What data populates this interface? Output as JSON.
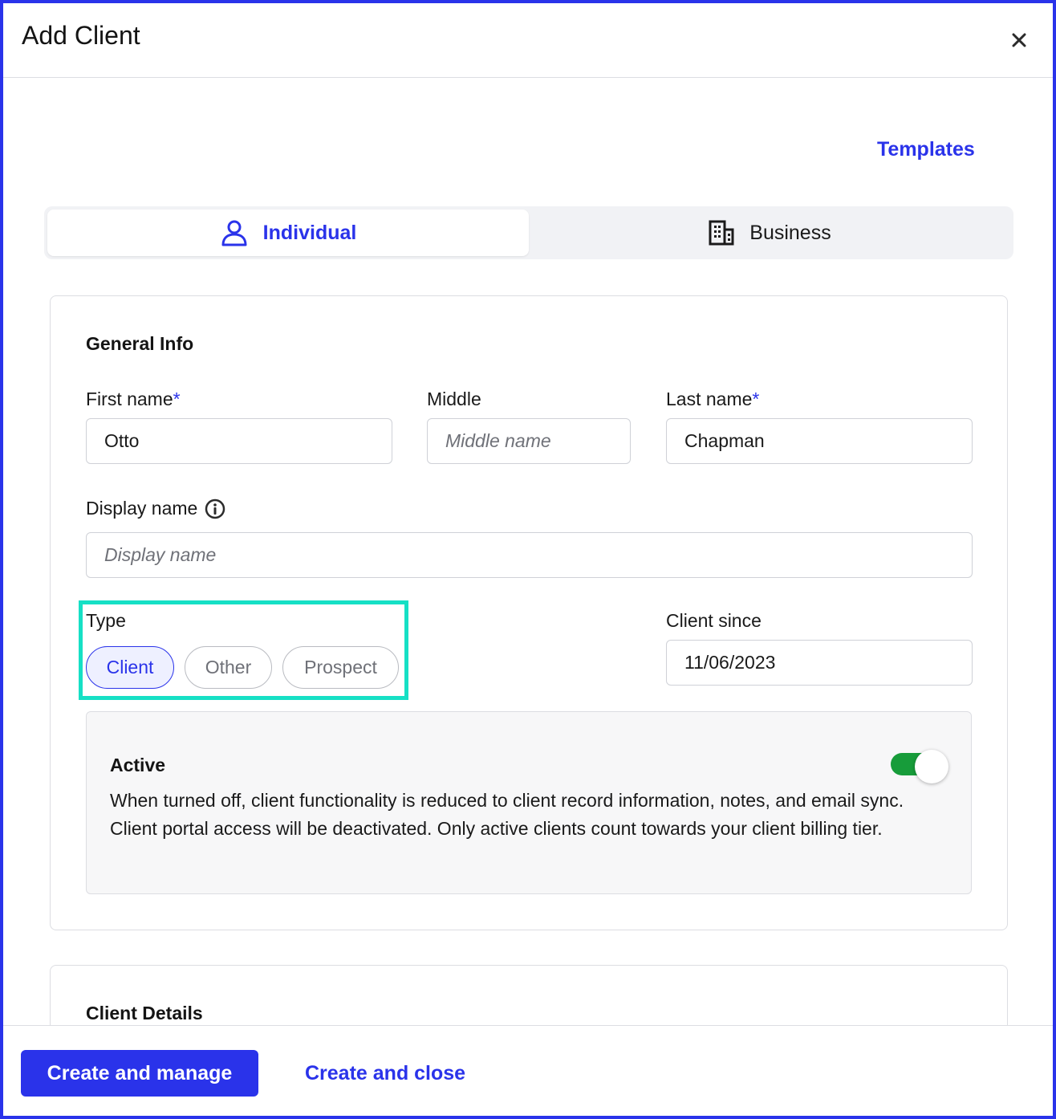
{
  "modal": {
    "title": "Add Client",
    "close_icon": "close-icon"
  },
  "templates_link": "Templates",
  "entity_tabs": [
    {
      "label": "Individual",
      "icon": "person-icon",
      "active": true
    },
    {
      "label": "Business",
      "icon": "building-icon",
      "active": false
    }
  ],
  "general_info": {
    "title": "General Info",
    "first_name": {
      "label": "First name",
      "required_mark": "*",
      "value": "Otto"
    },
    "middle": {
      "label": "Middle",
      "placeholder": "Middle name"
    },
    "last_name": {
      "label": "Last name",
      "required_mark": "*",
      "value": "Chapman"
    },
    "display_name": {
      "label": "Display name",
      "placeholder": "Display name",
      "info_icon": "info-icon"
    },
    "type": {
      "label": "Type",
      "options": [
        "Client",
        "Other",
        "Prospect"
      ],
      "selected": "Client"
    },
    "client_since": {
      "label": "Client since",
      "value": "11/06/2023"
    },
    "active": {
      "title": "Active",
      "enabled": true,
      "description": "When turned off, client functionality is reduced to client record information, notes, and email sync. Client portal access will be deactivated. Only active clients count towards your client billing tier."
    }
  },
  "client_details": {
    "title": "Client Details"
  },
  "footer": {
    "primary_label": "Create and manage",
    "secondary_label": "Create and close"
  },
  "colors": {
    "accent": "#2a33ea",
    "highlight": "#16e0c5",
    "toggle_on": "#179c3a"
  }
}
